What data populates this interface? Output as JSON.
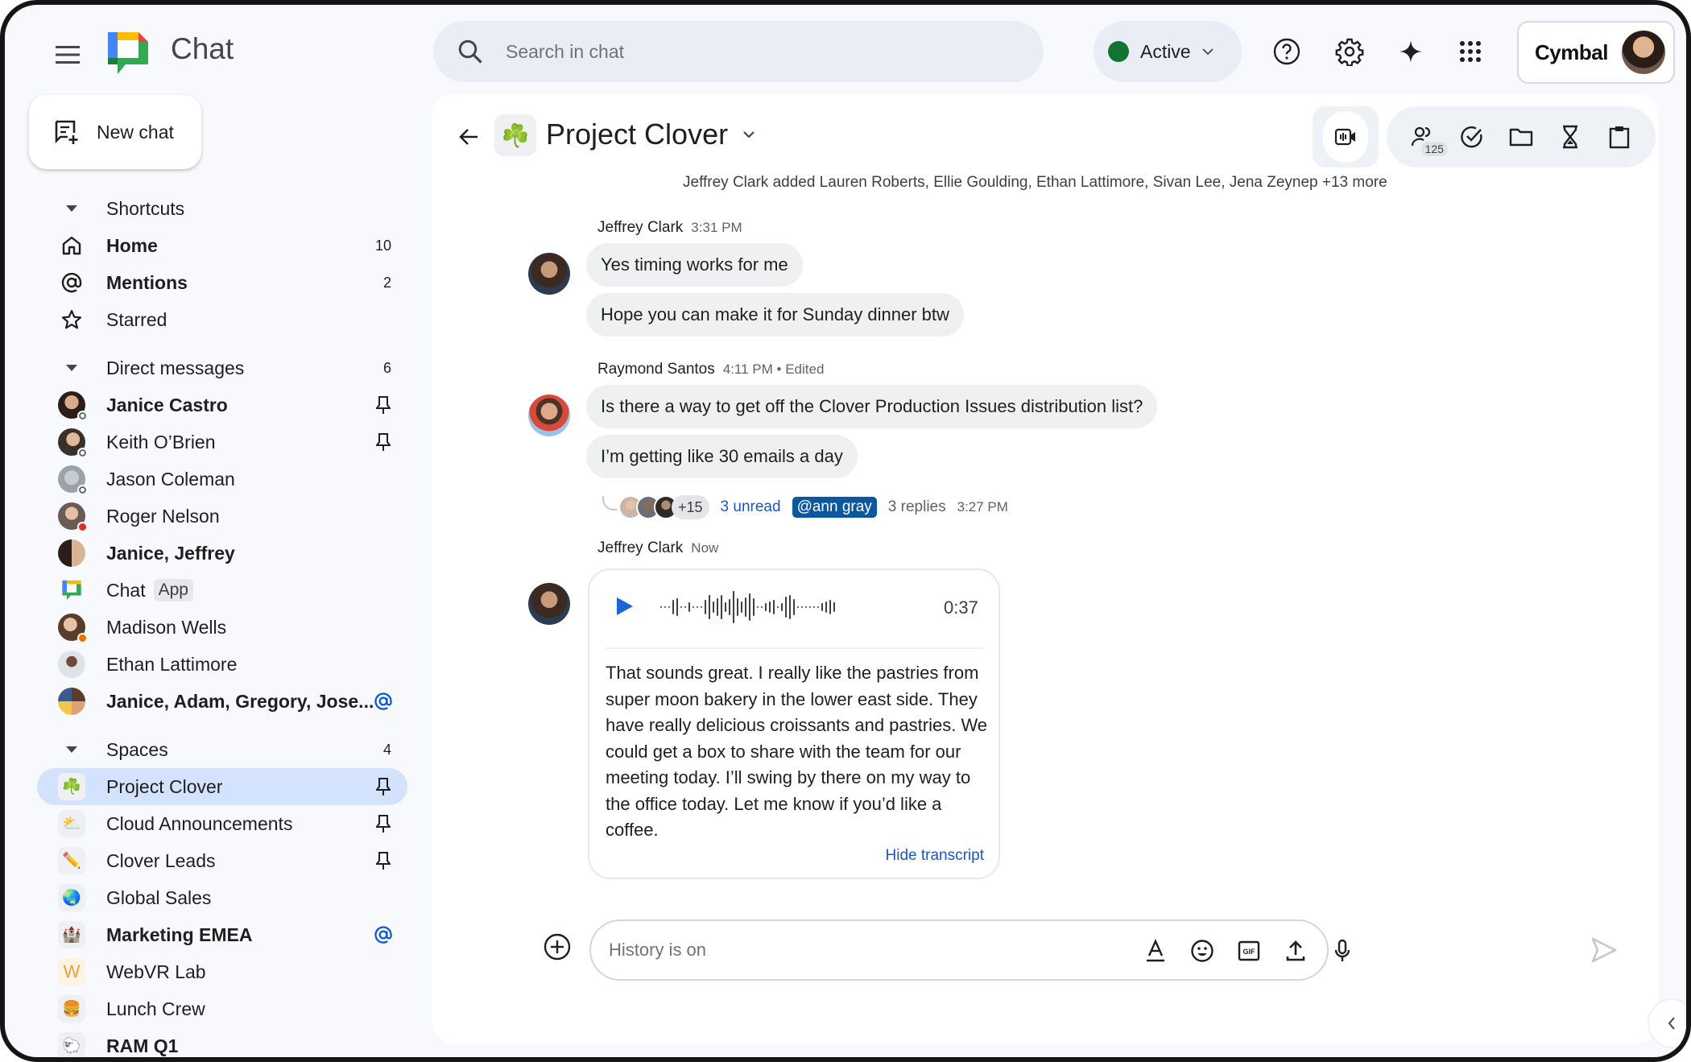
{
  "app": {
    "title": "Chat",
    "search_placeholder": "Search in chat",
    "status": {
      "label": "Active",
      "color": "#137333"
    },
    "account_brand": "Cymbal",
    "accent_color": "#1a56c5",
    "selected_color": "#d3e3fd"
  },
  "sidebar": {
    "new_chat_label": "New chat",
    "shortcuts": {
      "label": "Shortcuts",
      "items": [
        {
          "label": "Home",
          "icon": "home-icon",
          "count": "10",
          "bold": true
        },
        {
          "label": "Mentions",
          "icon": "at-sign-icon",
          "count": "2",
          "bold": true
        },
        {
          "label": "Starred",
          "icon": "star-icon",
          "count": "",
          "bold": false
        }
      ]
    },
    "direct_messages": {
      "label": "Direct messages",
      "count": "6",
      "items": [
        {
          "label": "Janice Castro",
          "bold": true,
          "pinned": true
        },
        {
          "label": "Keith O’Brien",
          "bold": false,
          "pinned": true
        },
        {
          "label": "Jason Coleman",
          "bold": false,
          "pinned": false
        },
        {
          "label": "Roger Nelson",
          "bold": false,
          "pinned": false
        },
        {
          "label": "Janice, Jeffrey",
          "bold": true,
          "pinned": false
        },
        {
          "label": "Chat",
          "badge": "App",
          "bold": false,
          "pinned": false
        },
        {
          "label": "Madison Wells",
          "bold": false,
          "pinned": false
        },
        {
          "label": "Ethan Lattimore",
          "bold": false,
          "pinned": false
        },
        {
          "label": "Janice, Adam, Gregory, Jose...",
          "bold": true,
          "mention": true
        }
      ]
    },
    "spaces": {
      "label": "Spaces",
      "count": "4",
      "items": [
        {
          "label": "Project Clover",
          "emoji": "☘️",
          "pinned": true,
          "selected": true
        },
        {
          "label": "Cloud Announcements",
          "emoji": "⛅",
          "pinned": true
        },
        {
          "label": "Clover Leads",
          "emoji": "✏️",
          "pinned": true
        },
        {
          "label": "Global Sales",
          "emoji": "🌏",
          "pinned": false
        },
        {
          "label": "Marketing EMEA",
          "emoji": "🏰",
          "bold": true,
          "mention": true
        },
        {
          "label": "WebVR Lab",
          "emoji": "W",
          "pinned": false
        },
        {
          "label": "Lunch Crew",
          "emoji": "🍔",
          "pinned": false
        },
        {
          "label": "RAM Q1",
          "emoji": "🐑",
          "bold": true
        }
      ]
    }
  },
  "conversation": {
    "title": "Project Clover",
    "members_count": "125",
    "system_message": "Jeffrey Clark added Lauren Roberts, Ellie Goulding, Ethan Lattimore, Sivan Lee, Jena Zeynep +13 more",
    "messages": [
      {
        "author": "Jeffrey Clark",
        "time": "3:31 PM",
        "lines": [
          "Yes timing works for me",
          "Hope you can make it for Sunday dinner btw"
        ]
      },
      {
        "author": "Raymond Santos",
        "time": "4:11 PM • Edited",
        "lines": [
          "Is there a way to get off the Clover Production Issues distribution list?",
          "I’m getting like 30 emails a day"
        ],
        "thread": {
          "more_participants": "+15",
          "unread": "3 unread",
          "mention": "@ann gray",
          "replies": "3 replies",
          "time": "3:27 PM"
        }
      },
      {
        "author": "Jeffrey Clark",
        "time": "Now",
        "voice": {
          "duration": "0:37",
          "transcript": "That sounds great. I really like the pastries from super moon bakery in the lower east side. They have really delicious croissants and pastries. We could get a box to share with the team for our meeting today. I’ll swing by there on my way to the office today. Let me know if you’d like a coffee.",
          "hide_label": "Hide transcript"
        }
      }
    ],
    "composer_placeholder": "History is on"
  }
}
